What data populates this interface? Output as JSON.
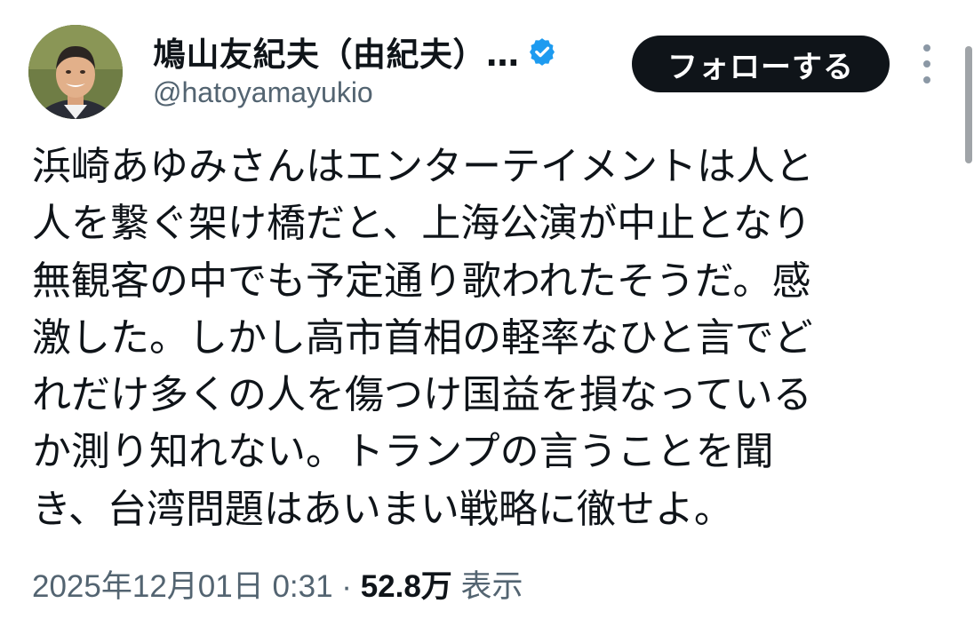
{
  "tweet": {
    "display_name": "鳩山友紀夫（由紀夫）…",
    "handle": "@hatoyamayukio",
    "follow_label": "フォローする",
    "text_lines": [
      "浜崎あゆみさんはエンターテイメントは人と",
      "人を繋ぐ架け橋だと、上海公演が中止となり",
      "無観客の中でも予定通り歌われたそうだ。感",
      "激した。しかし高市首相の軽率なひと言でど",
      "れだけ多くの人を傷つけ国益を損なっている",
      "か測り知れない。トランプの言うことを聞",
      "き、台湾問題はあいまい戦略に徹せよ。"
    ],
    "timestamp": "2025年12月01日 0:31",
    "separator": " · ",
    "views_count": "52.8万",
    "views_label": " 表示"
  },
  "icons": {
    "avatar": "avatar-icon",
    "verified": "verified-badge-icon",
    "more": "more-options-icon"
  },
  "colors": {
    "follow_button_bg": "#0f1419",
    "verified_blue": "#1d9bf0",
    "secondary_text": "#536471"
  }
}
